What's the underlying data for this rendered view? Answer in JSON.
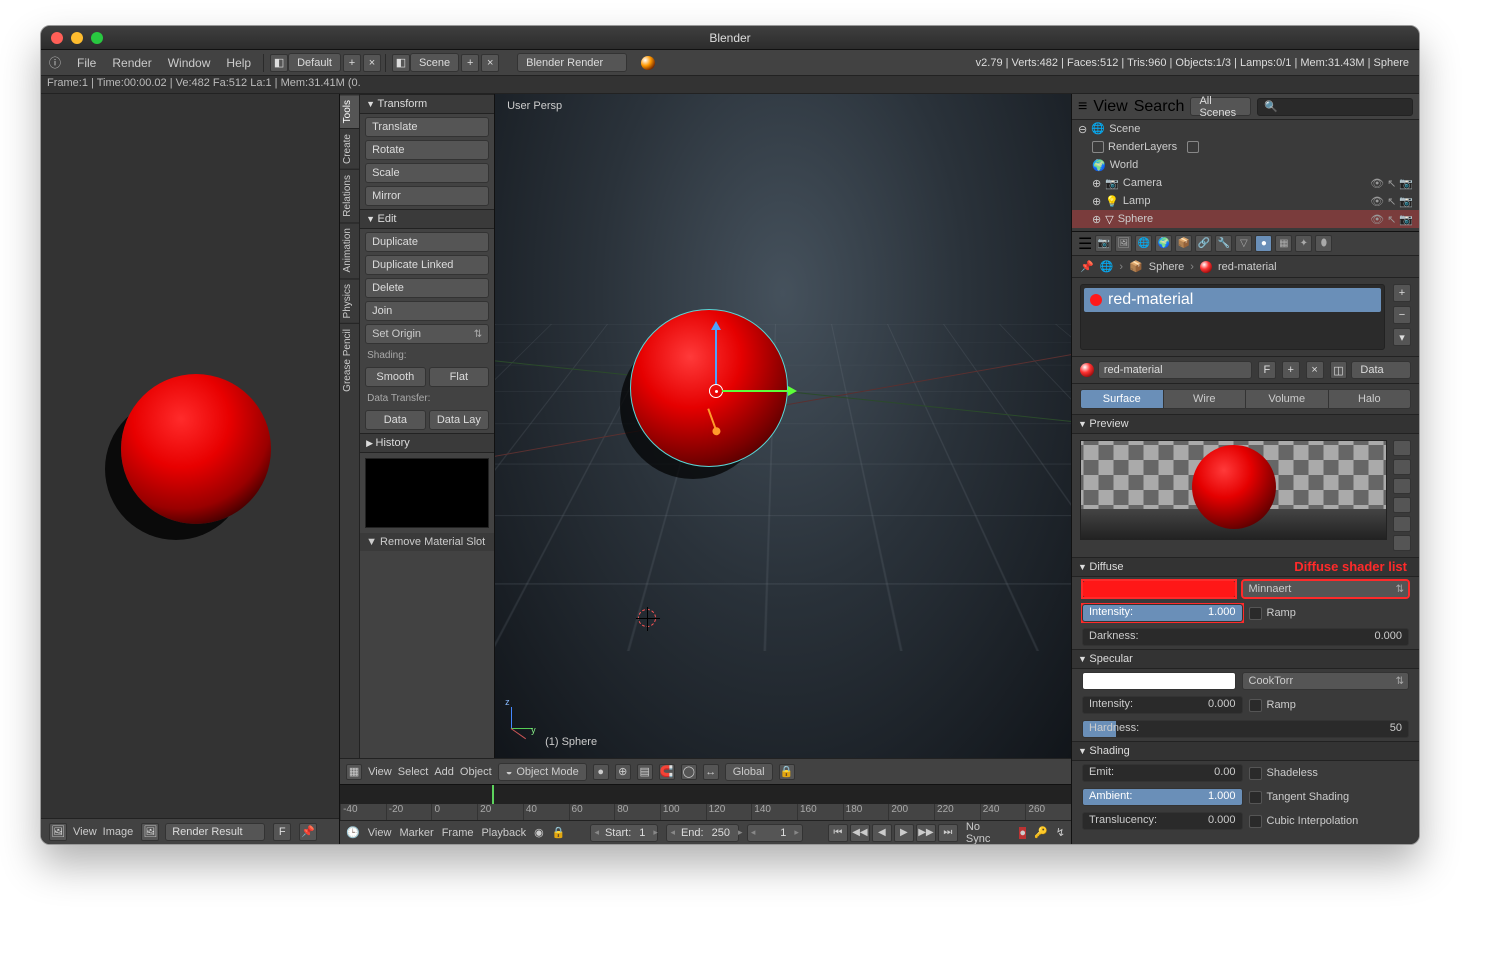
{
  "window_title": "Blender",
  "version_line": "v2.79",
  "menubar": {
    "items": [
      "File",
      "Render",
      "Window",
      "Help"
    ],
    "layout": "Default",
    "scene": "Scene",
    "engine": "Blender Render",
    "stats": "v2.79 | Verts:482 | Faces:512 | Tris:960 | Objects:1/3 | Lamps:0/1 | Mem:31.43M | Sphere"
  },
  "status_top": "Frame:1 | Time:00:00.02 | Ve:482 Fa:512 La:1 | Mem:31.41M (0.",
  "render_footer": {
    "menus": [
      "View",
      "Image"
    ],
    "result": "Render Result",
    "F": "F"
  },
  "viewport": {
    "label": "User Persp",
    "object_label": "(1) Sphere",
    "footer": {
      "menus": [
        "View",
        "Select",
        "Add",
        "Object"
      ],
      "mode": "Object Mode",
      "orientation": "Global"
    }
  },
  "toolshelf": {
    "tabs": [
      "Tools",
      "Create",
      "Relations",
      "Animation",
      "Physics",
      "Grease Pencil"
    ],
    "transform": {
      "title": "Transform",
      "ops": [
        "Translate",
        "Rotate",
        "Scale",
        "Mirror"
      ]
    },
    "edit": {
      "title": "Edit",
      "ops": [
        "Duplicate",
        "Duplicate Linked",
        "Delete",
        "Join"
      ],
      "set_origin": "Set Origin"
    },
    "shading": {
      "label": "Shading:",
      "smooth": "Smooth",
      "flat": "Flat"
    },
    "data_transfer": {
      "label": "Data Transfer:",
      "data": "Data",
      "data_lay": "Data Lay"
    },
    "history": {
      "title": "History"
    },
    "remove": "Remove Material Slot"
  },
  "outliner": {
    "header": {
      "view": "View",
      "search": "Search",
      "filter": "All Scenes"
    },
    "tree": [
      "Scene",
      "RenderLayers",
      "World",
      "Camera",
      "Lamp",
      "Sphere"
    ]
  },
  "breadcrumb": {
    "obj": "Sphere",
    "mat": "red-material"
  },
  "material": {
    "name": "red-material",
    "name_F": "F",
    "data_menu": "Data",
    "types": [
      "Surface",
      "Wire",
      "Volume",
      "Halo"
    ],
    "preview": "Preview",
    "diffuse": {
      "title": "Diffuse",
      "annot": "Diffuse shader list",
      "shader": "Minnaert",
      "intensity": {
        "label": "Intensity:",
        "value": "1.000",
        "fill": 100
      },
      "ramp": "Ramp",
      "darkness": {
        "label": "Darkness:",
        "value": "0.000",
        "fill": 0
      },
      "color": "#ff1717"
    },
    "specular": {
      "title": "Specular",
      "shader": "CookTorr",
      "color": "#ffffff",
      "intensity": {
        "label": "Intensity:",
        "value": "0.000",
        "fill": 0
      },
      "ramp": "Ramp",
      "hardness": {
        "label": "Hardness:",
        "value": "50",
        "fill": 10
      }
    },
    "shading": {
      "title": "Shading",
      "emit": {
        "label": "Emit:",
        "value": "0.00",
        "fill": 0
      },
      "ambient": {
        "label": "Ambient:",
        "value": "1.000",
        "fill": 100
      },
      "translucency": {
        "label": "Translucency:",
        "value": "0.000",
        "fill": 0
      },
      "shadeless": "Shadeless",
      "tangent": "Tangent Shading",
      "cubic": "Cubic Interpolation"
    }
  },
  "timeline": {
    "ruler": [
      "-40",
      "-20",
      "0",
      "20",
      "40",
      "60",
      "80",
      "100",
      "120",
      "140",
      "160",
      "180",
      "200",
      "220",
      "240",
      "260"
    ],
    "footer": {
      "menus": [
        "View",
        "Marker",
        "Frame",
        "Playback"
      ],
      "start": {
        "label": "Start:",
        "value": "1"
      },
      "end": {
        "label": "End:",
        "value": "250"
      },
      "current": "1",
      "sync": "No Sync"
    }
  }
}
